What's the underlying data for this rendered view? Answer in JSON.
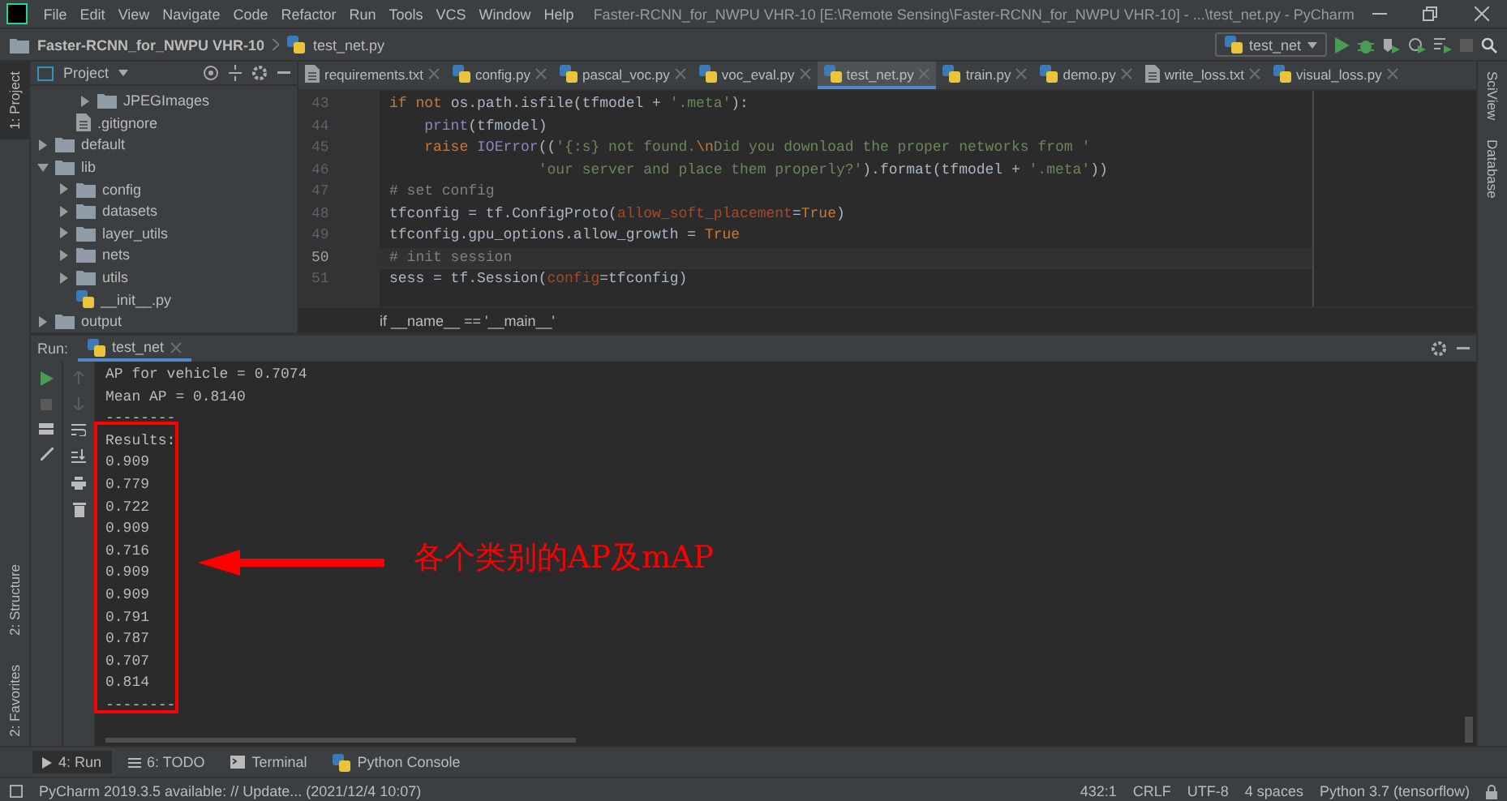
{
  "window": {
    "title": "Faster-RCNN_for_NWPU VHR-10 [E:\\Remote Sensing\\Faster-RCNN_for_NWPU VHR-10] - ...\\test_net.py - PyCharm"
  },
  "menu": [
    "File",
    "Edit",
    "View",
    "Navigate",
    "Code",
    "Refactor",
    "Run",
    "Tools",
    "VCS",
    "Window",
    "Help"
  ],
  "nav_bar": {
    "project": "Faster-RCNN_for_NWPU VHR-10",
    "file": "test_net.py",
    "run_config": "test_net"
  },
  "left_tool_tabs": [
    {
      "label": "1: Project",
      "selected": true,
      "kind": "top"
    },
    {
      "label": "2: Structure",
      "selected": false,
      "kind": "bottom"
    },
    {
      "label": "2: Favorites",
      "selected": false,
      "kind": "bottom"
    }
  ],
  "right_tool_tabs": [
    {
      "label": "SciView"
    },
    {
      "label": "Database"
    }
  ],
  "project_panel": {
    "title": "Project",
    "tree": [
      {
        "children": [
          {
            "children": [
              {
                "name": "JPEGImages",
                "kind": "folder",
                "expanded": false
              }
            ]
          },
          {
            "name": ".gitignore",
            "kind": "file"
          }
        ]
      },
      {
        "name": "default",
        "kind": "folder",
        "expanded": false
      },
      {
        "name": "lib",
        "kind": "folder",
        "expanded": true,
        "children": [
          {
            "name": "config",
            "kind": "folder",
            "expanded": false
          },
          {
            "name": "datasets",
            "kind": "folder",
            "expanded": false
          },
          {
            "name": "layer_utils",
            "kind": "folder",
            "expanded": false
          },
          {
            "name": "nets",
            "kind": "folder",
            "expanded": false
          },
          {
            "name": "utils",
            "kind": "folder",
            "expanded": false
          },
          {
            "name": "__init__.py",
            "kind": "python"
          }
        ]
      },
      {
        "name": "output",
        "kind": "folder",
        "expanded": false
      }
    ]
  },
  "editor_tabs": [
    {
      "label": "requirements.txt",
      "kind": "text",
      "selected": false
    },
    {
      "label": "config.py",
      "kind": "python",
      "selected": false
    },
    {
      "label": "pascal_voc.py",
      "kind": "python",
      "selected": false
    },
    {
      "label": "voc_eval.py",
      "kind": "python",
      "selected": false
    },
    {
      "label": "test_net.py",
      "kind": "python",
      "selected": true
    },
    {
      "label": "train.py",
      "kind": "python",
      "selected": false
    },
    {
      "label": "demo.py",
      "kind": "python",
      "selected": false
    },
    {
      "label": "write_loss.txt",
      "kind": "text",
      "selected": false
    },
    {
      "label": "visual_loss.py",
      "kind": "python",
      "selected": false
    }
  ],
  "code": [
    {
      "number": "43",
      "current": false,
      "tokens": [
        {
          "kind": "kw",
          "text": "if not "
        },
        {
          "kind": "plain",
          "text": "os.path.isfile(tfmodel + "
        },
        {
          "kind": "str",
          "text": "'.meta'"
        },
        {
          "kind": "plain",
          "text": "):"
        }
      ]
    },
    {
      "number": "44",
      "current": false,
      "tokens": [
        {
          "kind": "builtin",
          "text": "    print"
        },
        {
          "kind": "plain",
          "text": "(tfmodel)"
        }
      ]
    },
    {
      "number": "45",
      "current": false,
      "tokens": [
        {
          "kind": "kw",
          "text": "    raise "
        },
        {
          "kind": "builtin",
          "text": "IOError"
        },
        {
          "kind": "plain",
          "text": "(("
        },
        {
          "kind": "str",
          "text": "'{:s} not found."
        },
        {
          "kind": "kw",
          "text": "\\n"
        },
        {
          "kind": "str",
          "text": "Did you download the proper networks from '"
        }
      ]
    },
    {
      "number": "46",
      "current": false,
      "tokens": [
        {
          "kind": "str",
          "text": "                 'our server and place them properly?'"
        },
        {
          "kind": "plain",
          "text": ").format(tfmodel + "
        },
        {
          "kind": "str",
          "text": "'.meta'"
        },
        {
          "kind": "plain",
          "text": "))"
        }
      ]
    },
    {
      "number": "47",
      "current": false,
      "tokens": [
        {
          "kind": "comment",
          "text": "# set config"
        }
      ]
    },
    {
      "number": "48",
      "current": false,
      "tokens": [
        {
          "kind": "plain",
          "text": "tfconfig = tf.ConfigProto("
        },
        {
          "kind": "param",
          "text": "allow_soft_placement"
        },
        {
          "kind": "plain",
          "text": "="
        },
        {
          "kind": "kw",
          "text": "True"
        },
        {
          "kind": "plain",
          "text": ")"
        }
      ]
    },
    {
      "number": "49",
      "current": false,
      "tokens": [
        {
          "kind": "plain",
          "text": "tfconfig.gpu_options.allow_growth = "
        },
        {
          "kind": "kw",
          "text": "True"
        }
      ]
    },
    {
      "number": "50",
      "current": true,
      "tokens": [
        {
          "kind": "comment",
          "text": "# init session"
        }
      ]
    },
    {
      "number": "51",
      "current": false,
      "tokens": [
        {
          "kind": "plain",
          "text": "sess = tf.Session("
        },
        {
          "kind": "param",
          "text": "config"
        },
        {
          "kind": "plain",
          "text": "=tfconfig)"
        }
      ]
    }
  ],
  "editor_breadcrumb": "if __name__ == '__main__'",
  "run_panel": {
    "label": "Run:",
    "tab": "test_net",
    "console": [
      "AP for vehicle = 0.7074",
      "Mean AP = 0.8140",
      "--------",
      "Results:",
      "0.909",
      "0.779",
      "0.722",
      "0.909",
      "0.716",
      "0.909",
      "0.909",
      "0.791",
      "0.787",
      "0.707",
      "0.814",
      "--------"
    ]
  },
  "annotation": {
    "text": "各个类别的AP及mAP"
  },
  "bottom_tool_tabs": [
    {
      "label": "4: Run",
      "selected": true,
      "kind": "run"
    },
    {
      "label": "6: TODO",
      "selected": false,
      "kind": "todo"
    },
    {
      "label": "Terminal",
      "selected": false,
      "kind": "terminal"
    },
    {
      "label": "Python Console",
      "selected": false,
      "kind": "python"
    }
  ],
  "status_bar": {
    "message": "PyCharm 2019.3.5 available: // Update... (2021/12/4 10:07)",
    "items": [
      "432:1",
      "CRLF",
      "UTF-8",
      "4 spaces",
      "Python 3.7 (tensorflow)"
    ]
  }
}
